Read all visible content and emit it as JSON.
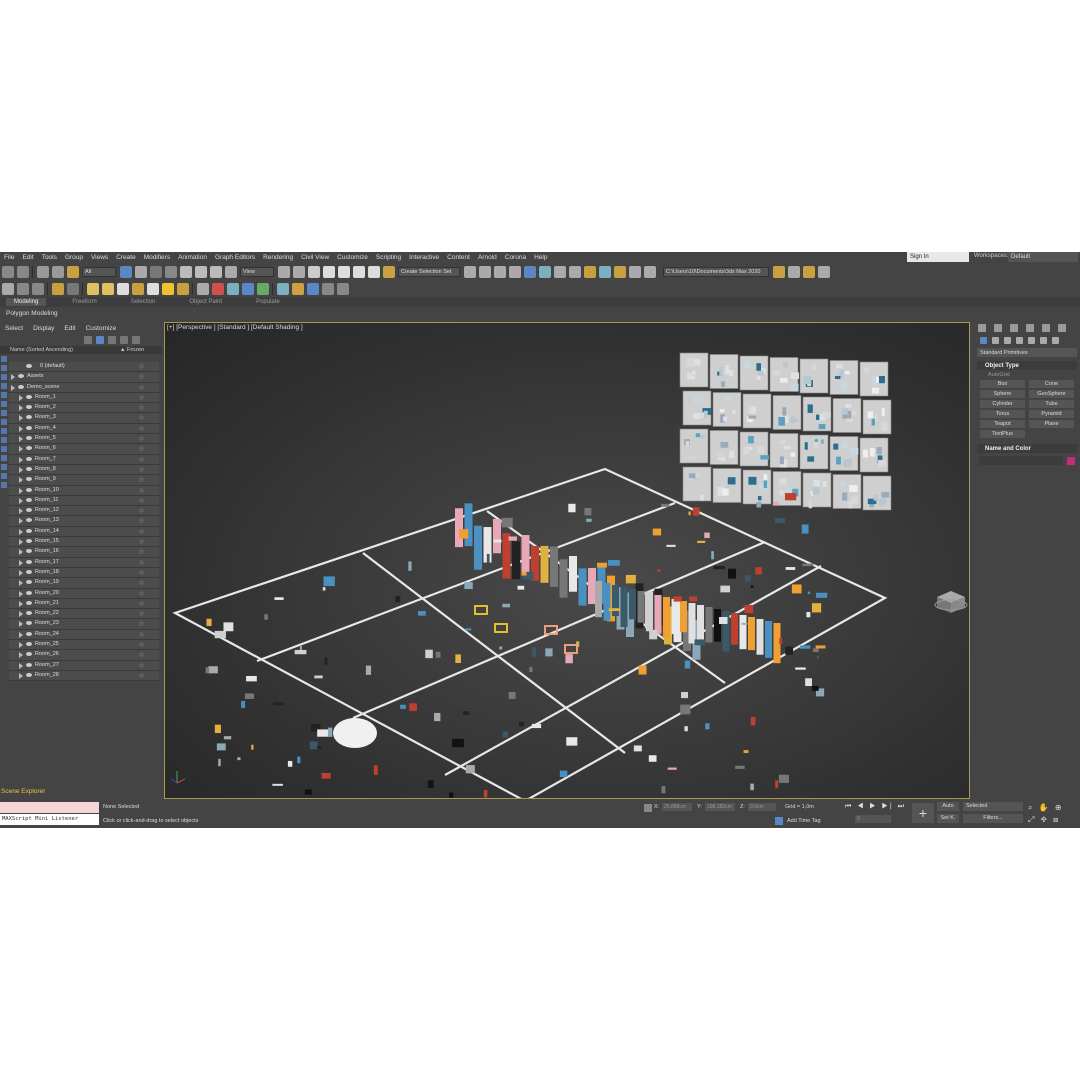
{
  "menu": [
    "File",
    "Edit",
    "Tools",
    "Group",
    "Views",
    "Create",
    "Modifiers",
    "Animation",
    "Graph Editors",
    "Rendering",
    "Civil View",
    "Customize",
    "Scripting",
    "Interactive",
    "Content",
    "Arnold",
    "Corona",
    "Help"
  ],
  "signin": "Sign In",
  "workspaces_label": "Workspaces:",
  "workspace_value": "Default",
  "toolbar": {
    "filter_all": "All",
    "view_dropdown": "View",
    "selection_set": "Create Selection Set",
    "path": "C:\\Users\\10\\Documents\\3ds Max 2020"
  },
  "ribbon": {
    "tabs": [
      "Modeling",
      "Freeform",
      "Selection",
      "Object Paint",
      "Populate"
    ],
    "active": "Modeling",
    "sub": "Polygon Modeling"
  },
  "scene_explorer": {
    "menu": [
      "Select",
      "Display",
      "Edit",
      "Customize"
    ],
    "col_name": "Name (Sorted Ascending)",
    "col_frozen": "▲ Frozen",
    "items": [
      "0 (default)",
      "Assets",
      "Demo_scene",
      "Room_1",
      "Room_2",
      "Room_3",
      "Room_4",
      "Room_5",
      "Room_6",
      "Room_7",
      "Room_8",
      "Room_9",
      "Room_10",
      "Room_11",
      "Room_12",
      "Room_13",
      "Room_14",
      "Room_15",
      "Room_16",
      "Room_17",
      "Room_18",
      "Room_19",
      "Room_20",
      "Room_21",
      "Room_22",
      "Room_23",
      "Room_24",
      "Room_25",
      "Room_26",
      "Room_27",
      "Room_28"
    ],
    "tab_label": "Scene Explorer"
  },
  "viewport": {
    "label": "[+] [Perspective ] [Standard ] [Default Shading ]"
  },
  "command_panel": {
    "dropdown": "Standard Primitives",
    "object_type": "Object Type",
    "autogrid": "AutoGrid",
    "primitives": [
      "Box",
      "Cone",
      "Sphere",
      "GeoSphere",
      "Cylinder",
      "Tube",
      "Torus",
      "Pyramid",
      "Teapot",
      "Plane",
      "TextPlus"
    ],
    "name_and_color": "Name and Color",
    "color": "#c0307a"
  },
  "status": {
    "maxscript": "MAXScript Mini Listener",
    "none_selected": "None Selected",
    "hint": "Click or click-and-drag to select objects",
    "x_label": "X:",
    "x_value": "25,888cm",
    "y_label": "Y:",
    "y_value": "108,182cm",
    "z_label": "Z:",
    "z_value": "0,0cm",
    "grid": "Grid = 1,0m",
    "add_time_tag": "Add Time Tag",
    "auto": "Auto",
    "set_key": "Set K.",
    "selected": "Selected",
    "filters": "Filters...",
    "frame": "0"
  }
}
